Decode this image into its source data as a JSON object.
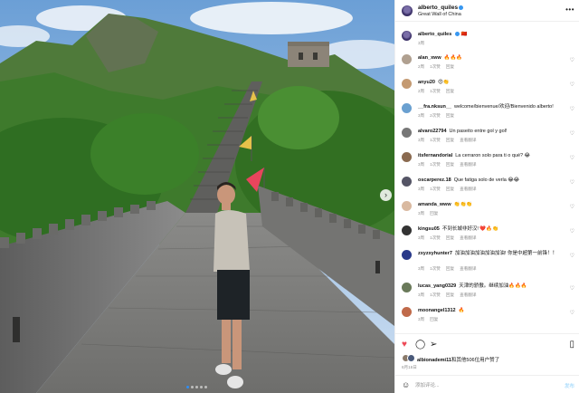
{
  "post": {
    "username": "alberto_quiles",
    "location": "Great Wall of China",
    "caption_flag": "🇨🇳",
    "caption_time": "3周"
  },
  "comments": [
    {
      "user": "alan_xww",
      "text": "🔥🔥🔥",
      "time": "2周",
      "likes": "1次赞",
      "reply": "回复",
      "translate": "",
      "avatar_color": "#b0a090"
    },
    {
      "user": "anyu20",
      "text": "😍👏",
      "time": "2周",
      "likes": "1次赞",
      "reply": "回复",
      "translate": "",
      "avatar_color": "#c49a72"
    },
    {
      "user": "__fra.nksun__",
      "text": "welcome/bienvenue/欢迎/Bienvenido alberto!",
      "time": "3周",
      "likes": "2次赞",
      "reply": "回复",
      "translate": "",
      "avatar_color": "#6aa0d0"
    },
    {
      "user": "alvaro22794",
      "text": "Un paseito entre gol y gol!",
      "time": "3周",
      "likes": "1次赞",
      "reply": "回复",
      "translate": "查看翻译",
      "avatar_color": "#777"
    },
    {
      "user": "itsfernandorial",
      "text": "La cerraron solo para ti o qué? 😂",
      "time": "3周",
      "likes": "1次赞",
      "reply": "回复",
      "translate": "查看翻译",
      "avatar_color": "#8a6a50"
    },
    {
      "user": "oscarperez.18",
      "text": "Que fatiga solo de verla 😂😂",
      "time": "3周",
      "likes": "1次赞",
      "reply": "回复",
      "translate": "查看翻译",
      "avatar_color": "#556"
    },
    {
      "user": "amanda_www",
      "text": "👏👏👏",
      "time": "3周",
      "likes": "",
      "reply": "回复",
      "translate": "",
      "avatar_color": "#d9b9a0"
    },
    {
      "user": "kingsu05",
      "text": "不到长城非好汉! ❤️🔥👏",
      "time": "3周",
      "likes": "1次赞",
      "reply": "回复",
      "translate": "查看翻译",
      "avatar_color": "#333"
    },
    {
      "user": "zxyzxyhunter7",
      "text": "加油加油加油加油加油! 你是中超第一前锋！！",
      "time": "3周",
      "likes": "1次赞",
      "reply": "回复",
      "translate": "查看翻译",
      "avatar_color": "#2a3a8a"
    },
    {
      "user": "lucas_yang0329",
      "text": "天津的骄傲。继续加油🔥🔥🔥",
      "time": "3周",
      "likes": "1次赞",
      "reply": "回复",
      "translate": "查看翻译",
      "avatar_color": "#6a7a5a"
    },
    {
      "user": "moonangel1312",
      "text": "🔥",
      "time": "3周",
      "likes": "",
      "reply": "回复",
      "translate": "",
      "avatar_color": "#c06a4a"
    }
  ],
  "actions": {
    "likes_text_user": "albionademi11",
    "likes_text_rest": "和其他506位用户赞了",
    "date": "6月16日"
  },
  "add_comment": {
    "placeholder": "添加评论...",
    "post_label": "发布"
  },
  "icons": {
    "more": "more-icon",
    "heart": "heart-icon",
    "comment": "comment-icon",
    "share": "share-icon",
    "save": "bookmark-icon",
    "emoji": "emoji-icon",
    "next": "chevron-right-icon"
  },
  "colors": {
    "like_red": "#ed4956",
    "verified_blue": "#3897f0",
    "post_button": "#b2dffc"
  }
}
